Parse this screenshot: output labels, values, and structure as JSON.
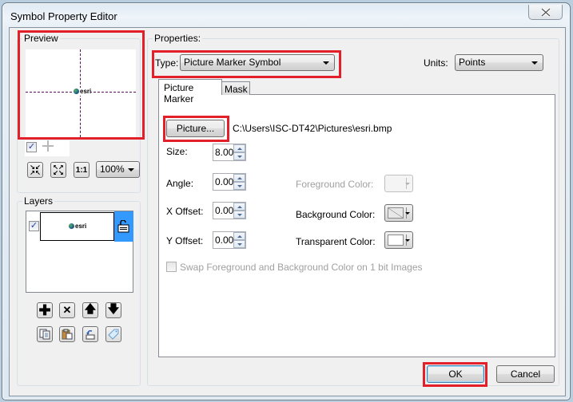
{
  "window": {
    "title": "Symbol Property Editor",
    "close_icon": "close-icon"
  },
  "preview": {
    "label": "Preview",
    "symbol_text": "esri",
    "show_checkbox_checked": true,
    "zoom_buttons": [
      "zoom-in-fit-icon",
      "zoom-out-fit-icon",
      "actual-size-icon"
    ],
    "actual_size_label": "1:1",
    "zoom_level": "100%"
  },
  "layers": {
    "label": "Layers",
    "items": [
      {
        "checked": true,
        "thumbnail_text": "esri",
        "locked": true,
        "selected": true
      }
    ],
    "action_buttons": [
      "add-layer",
      "remove-layer",
      "move-up",
      "move-down"
    ],
    "tool_buttons": [
      "copy-layer",
      "paste-layer",
      "restore-layer",
      "tag-layer"
    ]
  },
  "properties": {
    "label": "Properties:",
    "type_label": "Type:",
    "type_value": "Picture Marker Symbol",
    "units_label": "Units:",
    "units_value": "Points",
    "tabs": [
      {
        "label": "Picture Marker",
        "active": true
      },
      {
        "label": "Mask",
        "active": false
      }
    ],
    "picture_button": "Picture...",
    "picture_path": "C:\\Users\\ISC-DT42\\Pictures\\esri.bmp",
    "size_label": "Size:",
    "size_value": "8.00",
    "angle_label": "Angle:",
    "angle_value": "0.00",
    "xoffset_label": "X Offset:",
    "xoffset_value": "0.00",
    "yoffset_label": "Y Offset:",
    "yoffset_value": "0.00",
    "foreground_label": "Foreground Color:",
    "background_label": "Background Color:",
    "transparent_label": "Transparent Color:",
    "transparent_color": "#ffffff",
    "swap_label": "Swap Foreground and Background Color on 1 bit Images",
    "swap_checked": false
  },
  "footer": {
    "ok_label": "OK",
    "cancel_label": "Cancel"
  },
  "highlight_color": "#e3202a"
}
